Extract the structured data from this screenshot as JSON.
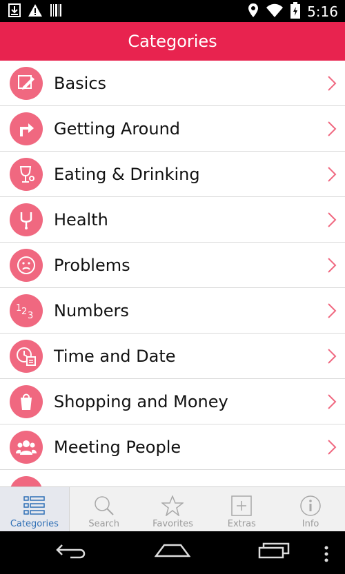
{
  "status": {
    "time": "5:16",
    "icons": [
      "download-icon",
      "warning-icon",
      "barcode-icon",
      "location-icon",
      "wifi-icon",
      "battery-icon"
    ]
  },
  "header": {
    "title": "Categories"
  },
  "categories": [
    {
      "label": "Basics",
      "icon": "pencil-icon"
    },
    {
      "label": "Getting Around",
      "icon": "turn-arrow-icon"
    },
    {
      "label": "Eating & Drinking",
      "icon": "glass-icon"
    },
    {
      "label": "Health",
      "icon": "stethoscope-icon"
    },
    {
      "label": "Problems",
      "icon": "sad-face-icon"
    },
    {
      "label": "Numbers",
      "icon": "numbers-icon"
    },
    {
      "label": "Time and Date",
      "icon": "clock-calendar-icon"
    },
    {
      "label": "Shopping and Money",
      "icon": "shopping-bag-icon"
    },
    {
      "label": "Meeting People",
      "icon": "people-icon"
    }
  ],
  "tabs": [
    {
      "label": "Categories",
      "icon": "list-icon",
      "active": true
    },
    {
      "label": "Search",
      "icon": "search-icon",
      "active": false
    },
    {
      "label": "Favorites",
      "icon": "star-icon",
      "active": false
    },
    {
      "label": "Extras",
      "icon": "plus-box-icon",
      "active": false
    },
    {
      "label": "Info",
      "icon": "info-icon",
      "active": false
    }
  ],
  "colors": {
    "accent": "#e8234f",
    "icon_bg": "#f06880",
    "tab_active": "#2f6fb5"
  }
}
